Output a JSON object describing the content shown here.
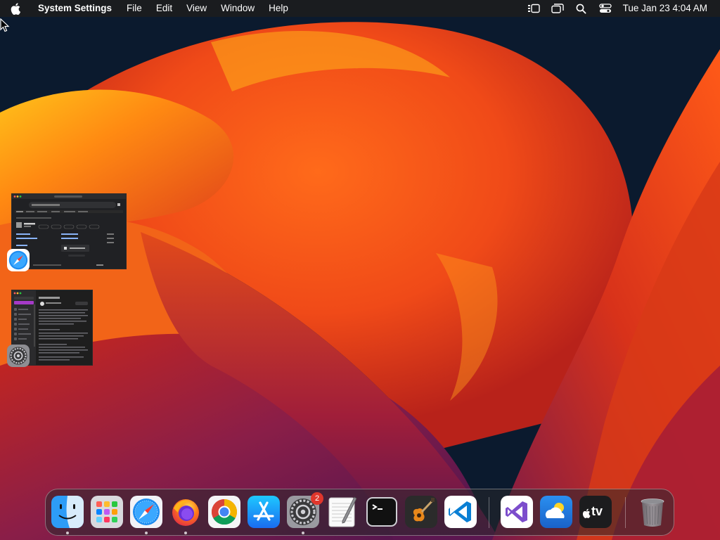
{
  "menubar": {
    "app_name": "System Settings",
    "menus": [
      "File",
      "Edit",
      "View",
      "Window",
      "Help"
    ],
    "clock": "Tue Jan 23  4:04 AM"
  },
  "stage": {
    "thumb_safari_search": "Google",
    "thumb_settings_title": "Settings"
  },
  "dock": {
    "system_settings_badge": "2",
    "appletv_label": "tv"
  },
  "colors": {
    "menubar": "#1c1c1e",
    "badge": "#e0362c",
    "wallpaper_orange": "#ff7a1a",
    "wallpaper_red": "#e0321a",
    "wallpaper_purple": "#6e1a55",
    "wallpaper_navy": "#0b1a2e"
  }
}
